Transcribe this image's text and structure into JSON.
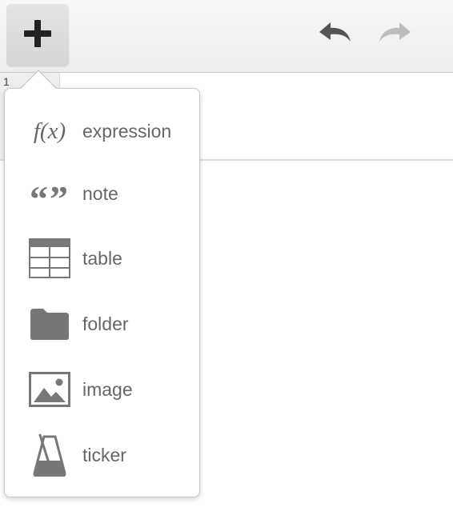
{
  "toolbar": {
    "add_button_icon": "plus-icon",
    "undo_icon": "undo-icon",
    "redo_icon": "redo-icon"
  },
  "expression_list": {
    "rows": [
      {
        "index": "1"
      }
    ]
  },
  "add_menu": {
    "items": [
      {
        "label": "expression",
        "icon": "function-icon",
        "glyph": "f(x)"
      },
      {
        "label": "note",
        "icon": "quote-icon",
        "glyph": "“”"
      },
      {
        "label": "table",
        "icon": "table-icon"
      },
      {
        "label": "folder",
        "icon": "folder-icon"
      },
      {
        "label": "image",
        "icon": "image-icon"
      },
      {
        "label": "ticker",
        "icon": "metronome-icon"
      }
    ]
  },
  "colors": {
    "icon_gray": "#777777",
    "text_gray": "#666666",
    "toolbar_bg": "#eeeeee"
  }
}
